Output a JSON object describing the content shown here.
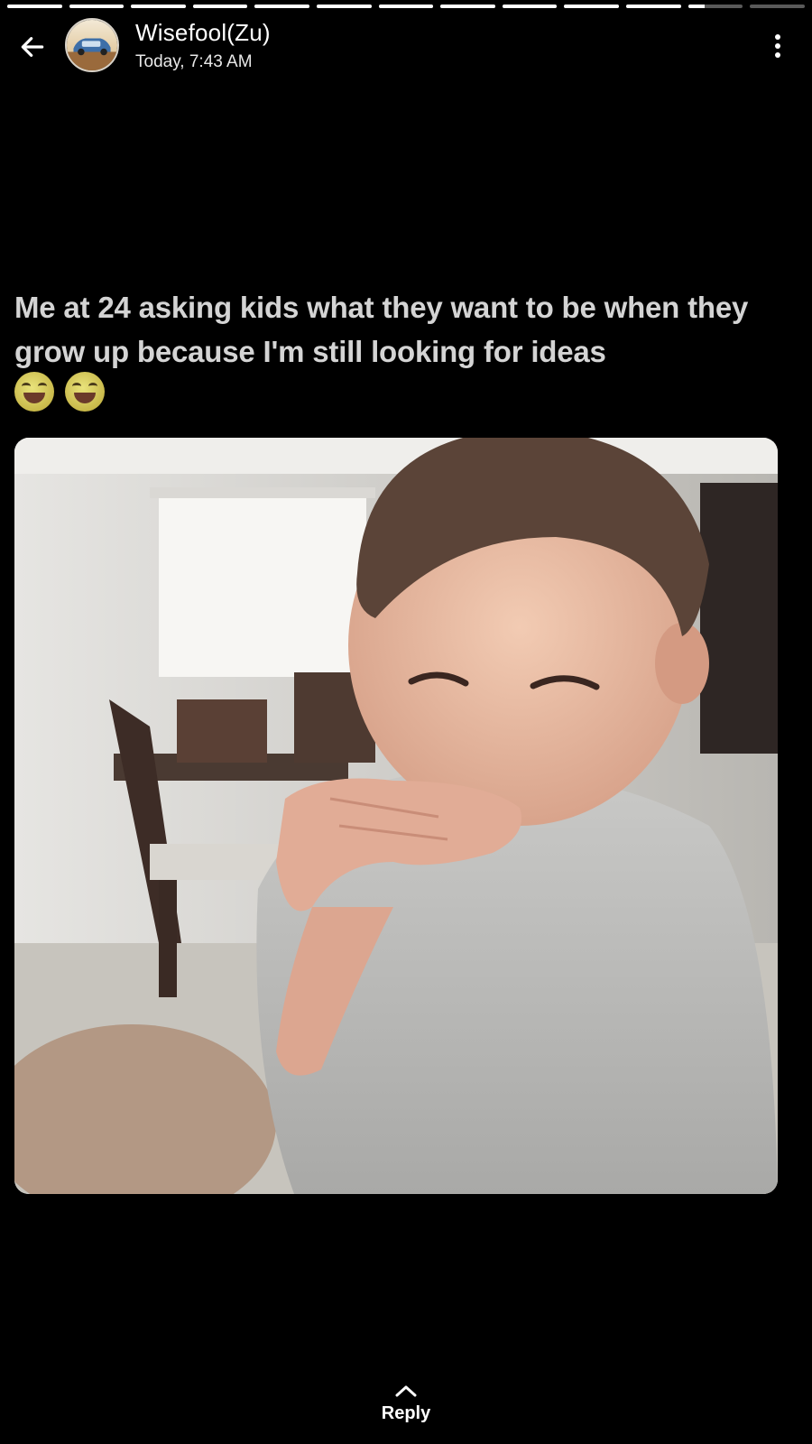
{
  "progress": {
    "segments": [
      1,
      1,
      1,
      1,
      1,
      1,
      1,
      1,
      1,
      1,
      1,
      0.3,
      0
    ],
    "active_color": "#ffffff",
    "inactive_color": "rgba(255,255,255,0.35)"
  },
  "header": {
    "back_icon": "arrow-left-icon",
    "author_name": "Wisefool(Zu)",
    "timestamp": "Today, 7:43 AM",
    "menu_icon": "kebab-menu-icon"
  },
  "story": {
    "caption": "Me at 24 asking kids what they want to be when they grow up because I'm still looking for ideas",
    "emojis": [
      "laughing-emoji",
      "laughing-emoji"
    ]
  },
  "footer": {
    "reply_icon": "chevron-up-icon",
    "reply_label": "Reply"
  }
}
